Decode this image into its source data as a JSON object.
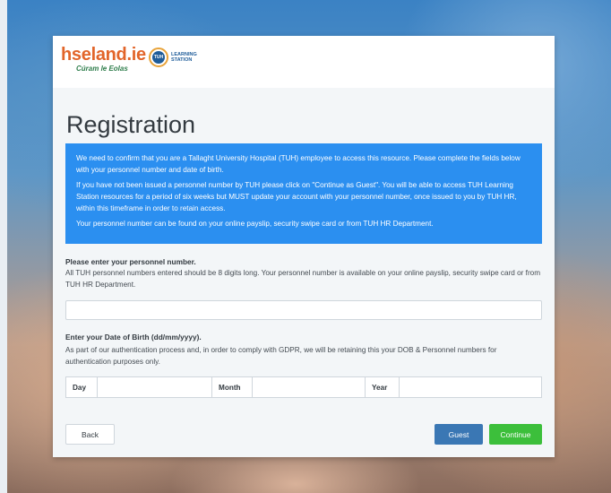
{
  "header": {
    "logo_main": "hseland.ie",
    "logo_sub": "Cúram le Eolas",
    "partner_badge": "TUH",
    "partner_text_line1": "LEARNING",
    "partner_text_line2": "STATION"
  },
  "page": {
    "title": "Registration"
  },
  "info": {
    "p1": "We need to confirm that you are a Tallaght University Hospital (TUH) employee to access this resource. Please complete the fields below with your personnel number and date of birth.",
    "p2": "If you have not been issued a personnel number by TUH please click on \"Continue as Guest\". You will be able to access TUH Learning Station resources for a period of six weeks but MUST update your account with your personnel number, once issued to you by TUH HR, within this timeframe in order to retain access.",
    "p3": "Your personnel number can be found on your online payslip, security swipe card or from TUH HR Department."
  },
  "personnel": {
    "label": "Please enter your personnel number.",
    "help": "All TUH personnel numbers entered should be 8 digits long. Your personnel number is available on your online payslip, security swipe card or from TUH HR Department.",
    "value": ""
  },
  "dob": {
    "label": "Enter your Date of Birth (dd/mm/yyyy).",
    "help": "As part of our authentication process and, in order to comply with GDPR, we will be retaining this your DOB & Personnel numbers for authentication purposes only.",
    "day_label": "Day",
    "month_label": "Month",
    "year_label": "Year"
  },
  "buttons": {
    "back": "Back",
    "guest": "Guest",
    "continue": "Continue"
  },
  "colors": {
    "info_bg": "#2b8ff0",
    "guest_bg": "#3a77b4",
    "continue_bg": "#3cbf3b",
    "logo_orange": "#e2652a"
  }
}
